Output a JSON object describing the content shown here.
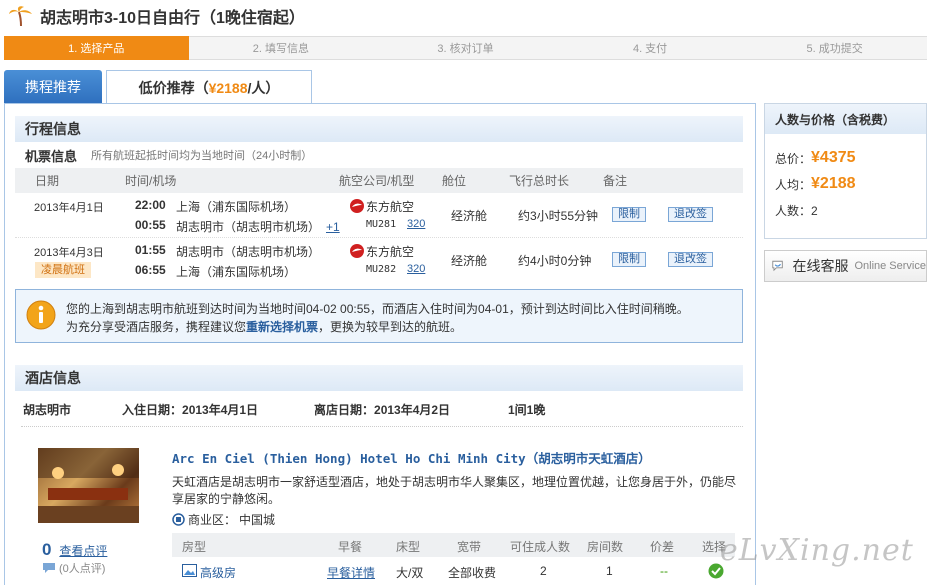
{
  "page": {
    "title": "胡志明市3-10日自由行（1晚住宿起）"
  },
  "steps": [
    "1. 选择产品",
    "2. 填写信息",
    "3. 核对订单",
    "4. 支付",
    "5. 成功提交"
  ],
  "tabs": {
    "recommend": "携程推荐",
    "cheap_label": "低价推荐（",
    "cheap_price": "¥2188",
    "cheap_unit": "/人）"
  },
  "itinerary": {
    "title": "行程信息",
    "ticket_title": "机票信息",
    "ticket_note": "所有航班起抵时间均为当地时间（24小时制）",
    "headers": [
      "日期",
      "时间/机场",
      "航空公司/机型",
      "舱位",
      "飞行总时长",
      "备注"
    ],
    "flights": [
      {
        "date": "2013年4月1日",
        "badge": "",
        "dep_time": "22:00",
        "dep_airport": "上海（浦东国际机场）",
        "arr_time": "00:55",
        "arr_airport": "胡志明市（胡志明市机场）",
        "plus": "+1",
        "airline": "东方航空",
        "flight_no": "MU281",
        "model": "320",
        "cabin": "经济舱",
        "duration": "约3小时55分钟"
      },
      {
        "date": "2013年4月3日",
        "badge": "凌晨航班",
        "dep_time": "01:55",
        "dep_airport": "胡志明市（胡志明市机场）",
        "arr_time": "06:55",
        "arr_airport": "上海（浦东国际机场）",
        "plus": "",
        "airline": "东方航空",
        "flight_no": "MU282",
        "model": "320",
        "cabin": "经济舱",
        "duration": "约4小时0分钟"
      }
    ],
    "btn_limit": "限制",
    "btn_change": "退改签",
    "notice_1": "您的上海到胡志明市航班到达时间为当地时间04-02 00:55，而酒店入住时间为04-01，预计到达时间比入住时间稍晚。",
    "notice_2a": "为充分享受酒店服务，携程建议您",
    "notice_link": "重新选择机票",
    "notice_2b": "，更换为较早到达的航班。"
  },
  "hotel": {
    "title": "酒店信息",
    "city": "胡志明市",
    "checkin_label": "入住日期：",
    "checkin": "2013年4月1日",
    "checkout_label": "离店日期：",
    "checkout": "2013年4月2日",
    "nights": "1间1晚",
    "name": "Arc En Ciel (Thien Hong) Hotel Ho Chi Minh City（胡志明市天虹酒店）",
    "desc": "天虹酒店是胡志明市一家舒适型酒店，地处于胡志明市华人聚集区，地理位置优越，让您身居于外，仍能尽享居家的宁静悠闲。",
    "area_label": "商业区：",
    "area": "中国城",
    "review_count": "0",
    "review_link": "查看点评",
    "review_note": "(0人点评)",
    "room_headers": [
      "房型",
      "早餐",
      "床型",
      "宽带",
      "可住成人数",
      "房间数",
      "价差",
      "选择"
    ],
    "room": {
      "type": "高级房",
      "breakfast": "早餐详情",
      "bed": "大/双",
      "broadband": "全部收费",
      "adults": "2",
      "rooms": "1",
      "diff": "--"
    }
  },
  "sidebar": {
    "title": "人数与价格（含税费）",
    "total_label": "总价：",
    "total": "¥4375",
    "avg_label": "人均：",
    "avg": "¥2188",
    "people_label": "人数：",
    "people": "2",
    "service": "在线客服",
    "service_en": "Online Service"
  },
  "watermark": "eLvXing.net"
}
